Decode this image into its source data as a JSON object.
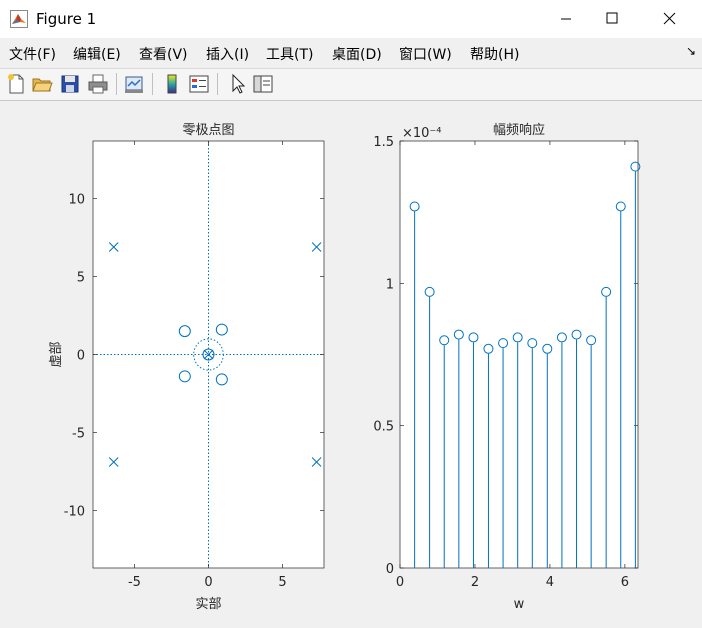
{
  "window": {
    "title": "Figure 1"
  },
  "menu": [
    {
      "label": "文件(F)"
    },
    {
      "label": "编辑(E)"
    },
    {
      "label": "查看(V)"
    },
    {
      "label": "插入(I)"
    },
    {
      "label": "工具(T)"
    },
    {
      "label": "桌面(D)"
    },
    {
      "label": "窗口(W)"
    },
    {
      "label": "帮助(H)"
    }
  ],
  "toolbar": [
    "new-figure-icon",
    "open-file-icon",
    "save-icon",
    "print-icon",
    "link-plot-icon",
    "colorbar-icon",
    "legend-icon",
    "pointer-icon",
    "property-editor-icon"
  ],
  "colors": {
    "plot": "#0072bd",
    "axes_bg": "#ffffff",
    "figure_bg": "#f0f0f0"
  },
  "chart_data": [
    {
      "type": "scatter",
      "title": "零极点图",
      "xlabel": "实部",
      "ylabel": "虚部",
      "xlim": [
        -7.8,
        7.8
      ],
      "ylim": [
        -13.7,
        13.7
      ],
      "xticks": [
        "-5",
        "0",
        "5"
      ],
      "yticks": [
        "10",
        "5",
        "0",
        "-5",
        "-10"
      ],
      "series": [
        {
          "marker": "o",
          "points": [
            [
              -1.6,
              1.5
            ],
            [
              0.9,
              1.6
            ],
            [
              -1.6,
              -1.4
            ],
            [
              0.9,
              -1.6
            ],
            [
              0,
              0
            ]
          ]
        },
        {
          "marker": "x",
          "points": [
            [
              -6.4,
              6.9
            ],
            [
              7.3,
              6.9
            ],
            [
              -6.4,
              -6.9
            ],
            [
              7.3,
              -6.9
            ],
            [
              0,
              0
            ]
          ]
        }
      ]
    },
    {
      "type": "stem",
      "title": "幅频响应",
      "xlabel": "w",
      "ylabel": "",
      "xlim": [
        0,
        6.35
      ],
      "ylim": [
        0,
        1.5
      ],
      "exponent": "×10⁻⁴",
      "xticks": [
        "0",
        "2",
        "4",
        "6"
      ],
      "yticks": [
        "1.5",
        "1",
        "0.5",
        "0"
      ],
      "x": [
        0.39,
        0.79,
        1.18,
        1.57,
        1.96,
        2.36,
        2.75,
        3.14,
        3.53,
        3.93,
        4.32,
        4.71,
        5.1,
        5.5,
        5.89,
        6.28
      ],
      "values": [
        1.27,
        0.97,
        0.8,
        0.82,
        0.81,
        0.77,
        0.79,
        0.81,
        0.79,
        0.77,
        0.81,
        0.82,
        0.8,
        0.97,
        1.27,
        1.41
      ]
    }
  ]
}
